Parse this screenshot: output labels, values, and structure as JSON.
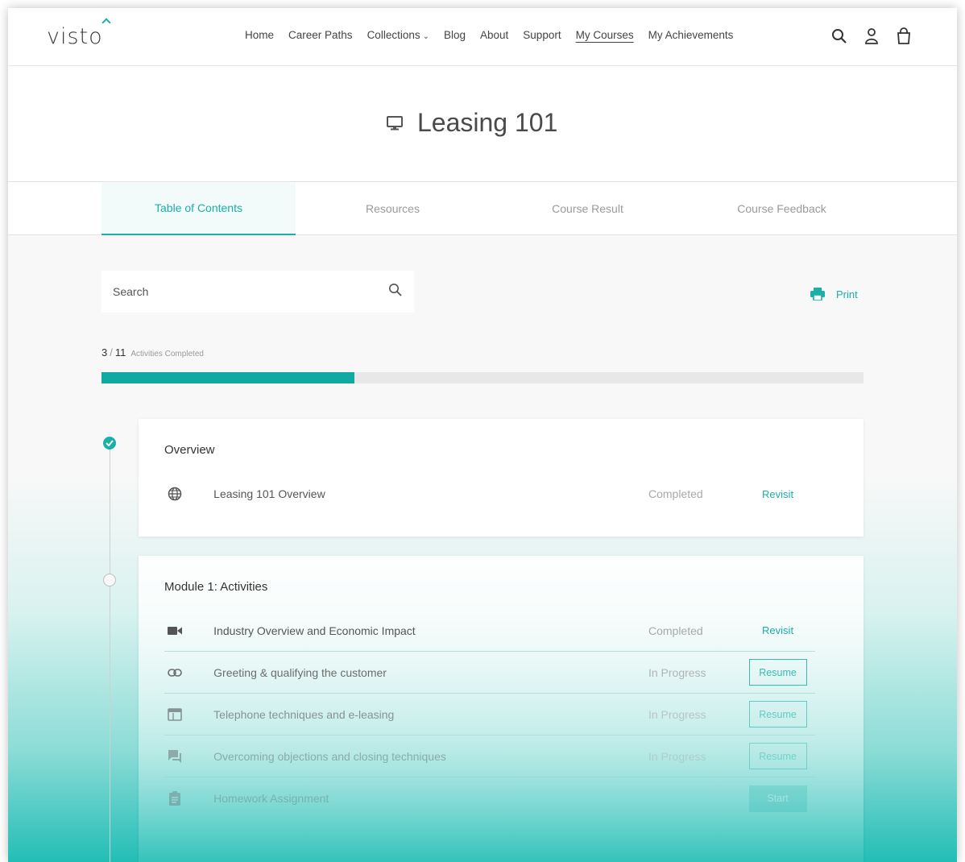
{
  "brand": {
    "logo": "visto",
    "accent": "#1ab0a8"
  },
  "nav": {
    "items": [
      "Home",
      "Career Paths",
      "Collections",
      "Blog",
      "About",
      "Support",
      "My Courses",
      "My Achievements"
    ],
    "active": "My Courses"
  },
  "header_icons": [
    "search-icon",
    "account-icon",
    "cart-icon"
  ],
  "course": {
    "title": "Leasing 101",
    "icon": "monitor-icon"
  },
  "tabs": [
    {
      "label": "Table of Contents",
      "active": true
    },
    {
      "label": "Resources",
      "active": false
    },
    {
      "label": "Course Result",
      "active": false
    },
    {
      "label": "Course Feedback",
      "active": false
    }
  ],
  "search": {
    "placeholder": "Search"
  },
  "print": {
    "label": "Print"
  },
  "progress": {
    "completed": "3",
    "separator": "/",
    "total": "11",
    "label": "Activities Completed",
    "fraction": 0.332
  },
  "sections": [
    {
      "title": "Overview",
      "status": "done",
      "rows": [
        {
          "icon": "globe-icon",
          "name": "Leasing 101 Overview",
          "status": "Completed",
          "action": "Revisit"
        }
      ]
    },
    {
      "title": "Module 1: Activities",
      "status": "open",
      "rows": [
        {
          "icon": "video-icon",
          "name": "Industry Overview and Economic Impact",
          "status": "Completed",
          "action": "Revisit"
        },
        {
          "icon": "link-icon",
          "name": "Greeting & qualifying the customer",
          "status": "In Progress",
          "action": "Resume"
        },
        {
          "icon": "web-icon",
          "name": "Telephone techniques and e-leasing",
          "status": "In Progress",
          "action": "Resume"
        },
        {
          "icon": "chat-icon",
          "name": "Overcoming objections and closing techniques",
          "status": "In Progress",
          "action": "Resume"
        },
        {
          "icon": "assignment-icon",
          "name": "Homework Assignment",
          "status": "",
          "action": "Start"
        }
      ]
    }
  ]
}
